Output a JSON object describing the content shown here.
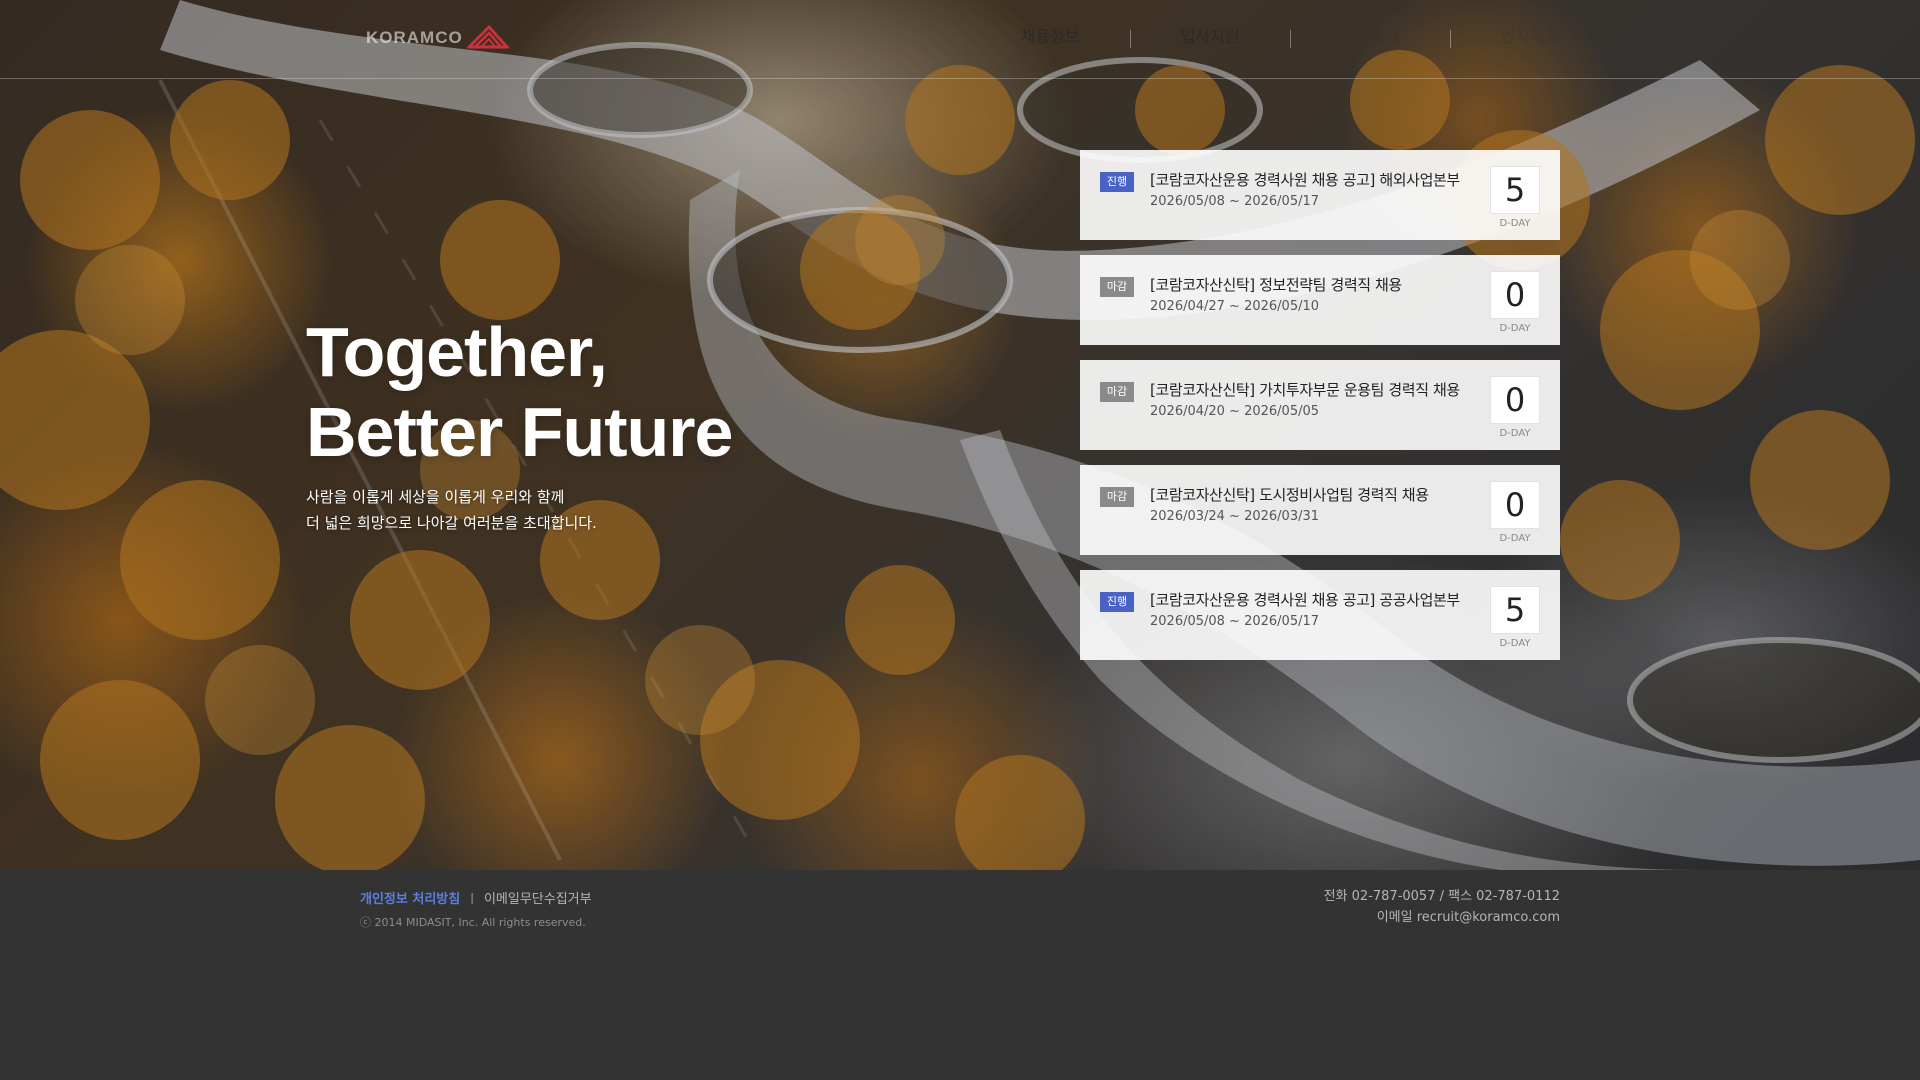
{
  "header": {
    "logo_text": "KORAMCO",
    "nav": [
      "채용정보",
      "입사지원",
      "회사소개",
      "인사제도"
    ]
  },
  "hero": {
    "title_line1": "Together,",
    "title_line2": "Better Future",
    "sub_line1": "사람을 이롭게 세상을 이롭게 우리와 함께",
    "sub_line2": "더 넓은 희망으로 나아갈 여러분을 초대합니다."
  },
  "jobs": [
    {
      "status": "진행",
      "title": "[코람코자산운용 경력사원 채용 공고] 해외사업본부",
      "period": "2026/05/08 ~ 2026/05/17",
      "dday": "5",
      "dday_label": "D-DAY"
    },
    {
      "status": "마감",
      "title": "[코람코자산신탁] 정보전략팀 경력직 채용",
      "period": "2026/04/27 ~ 2026/05/10",
      "dday": "0",
      "dday_label": "D-DAY"
    },
    {
      "status": "마감",
      "title": "[코람코자산신탁] 가치투자부문 운용팀 경력직 채용",
      "period": "2026/04/20 ~ 2026/05/05",
      "dday": "0",
      "dday_label": "D-DAY"
    },
    {
      "status": "마감",
      "title": "[코람코자산신탁] 도시정비사업팀 경력직 채용",
      "period": "2026/03/24 ~ 2026/03/31",
      "dday": "0",
      "dday_label": "D-DAY"
    },
    {
      "status": "진행",
      "title": "[코람코자산운용 경력사원 채용 공고] 공공사업본부",
      "period": "2026/05/08 ~ 2026/05/17",
      "dday": "5",
      "dday_label": "D-DAY"
    }
  ],
  "footer": {
    "privacy": "개인정보 처리방침",
    "separator": "|",
    "email_refuse": "이메일무단수집거부",
    "copyright": "ⓒ 2014 MIDASIT, Inc. All rights reserved.",
    "phone_fax": "전화 02-787-0057 / 팩스 02-787-0112",
    "email": "이메일 recruit@koramco.com"
  },
  "colors": {
    "badge_open": "#4a63c3",
    "badge_closed": "#8a8a8a",
    "footer_bg": "#333333",
    "privacy_link": "#5b7fe0",
    "logo_mark": "#c8323c"
  }
}
